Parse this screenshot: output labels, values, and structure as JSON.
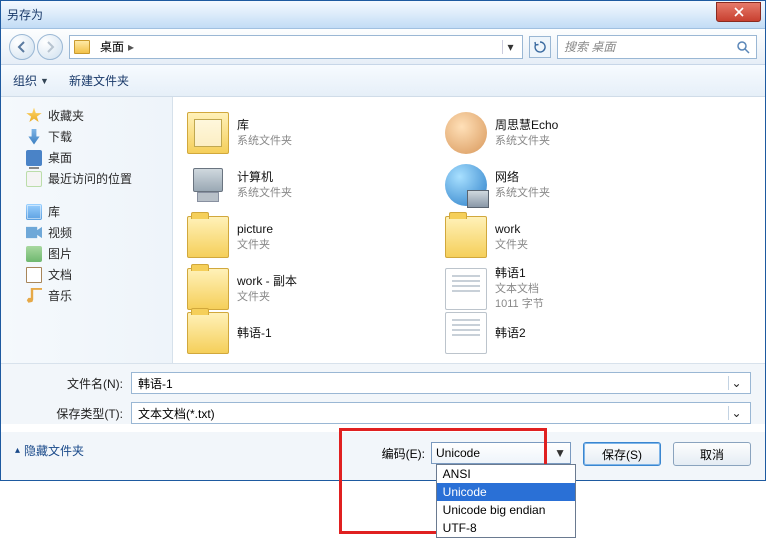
{
  "title": "另存为",
  "nav": {
    "location": "桌面",
    "search_placeholder": "搜索 桌面"
  },
  "toolbar": {
    "organize": "组织",
    "new_folder": "新建文件夹"
  },
  "sidebar": {
    "favorites": {
      "label": "收藏夹",
      "items": [
        {
          "label": "下载"
        },
        {
          "label": "桌面"
        },
        {
          "label": "最近访问的位置"
        }
      ]
    },
    "libraries": {
      "label": "库",
      "items": [
        {
          "label": "视频"
        },
        {
          "label": "图片"
        },
        {
          "label": "文档"
        },
        {
          "label": "音乐"
        }
      ]
    }
  },
  "content": {
    "sys_folder": "系统文件夹",
    "folder_label": "文件夹",
    "txt_label": "文本文档",
    "items": [
      {
        "name": "库",
        "sub": "系统文件夹",
        "kind": "lib"
      },
      {
        "name": "周思慧Echo",
        "sub": "系统文件夹",
        "kind": "user"
      },
      {
        "name": "计算机",
        "sub": "系统文件夹",
        "kind": "computer"
      },
      {
        "name": "网络",
        "sub": "系统文件夹",
        "kind": "network"
      },
      {
        "name": "picture",
        "sub": "文件夹",
        "kind": "folder"
      },
      {
        "name": "work",
        "sub": "文件夹",
        "kind": "folder"
      },
      {
        "name": "work - 副本",
        "sub": "文件夹",
        "kind": "folder"
      },
      {
        "name": "韩语1",
        "sub": "文本文档",
        "sub2": "1011 字节",
        "kind": "txt"
      },
      {
        "name": "韩语-1",
        "kind": "folder"
      },
      {
        "name": "韩语2",
        "kind": "txt"
      }
    ]
  },
  "filename": {
    "label": "文件名(N):",
    "value": "韩语-1"
  },
  "filetype": {
    "label": "保存类型(T):",
    "value": "文本文档(*.txt)"
  },
  "hide_folders": "隐藏文件夹",
  "encoding": {
    "label": "编码(E):",
    "value": "Unicode",
    "options": [
      "ANSI",
      "Unicode",
      "Unicode big endian",
      "UTF-8"
    ],
    "selected_index": 1
  },
  "buttons": {
    "save": "保存(S)",
    "cancel": "取消"
  }
}
